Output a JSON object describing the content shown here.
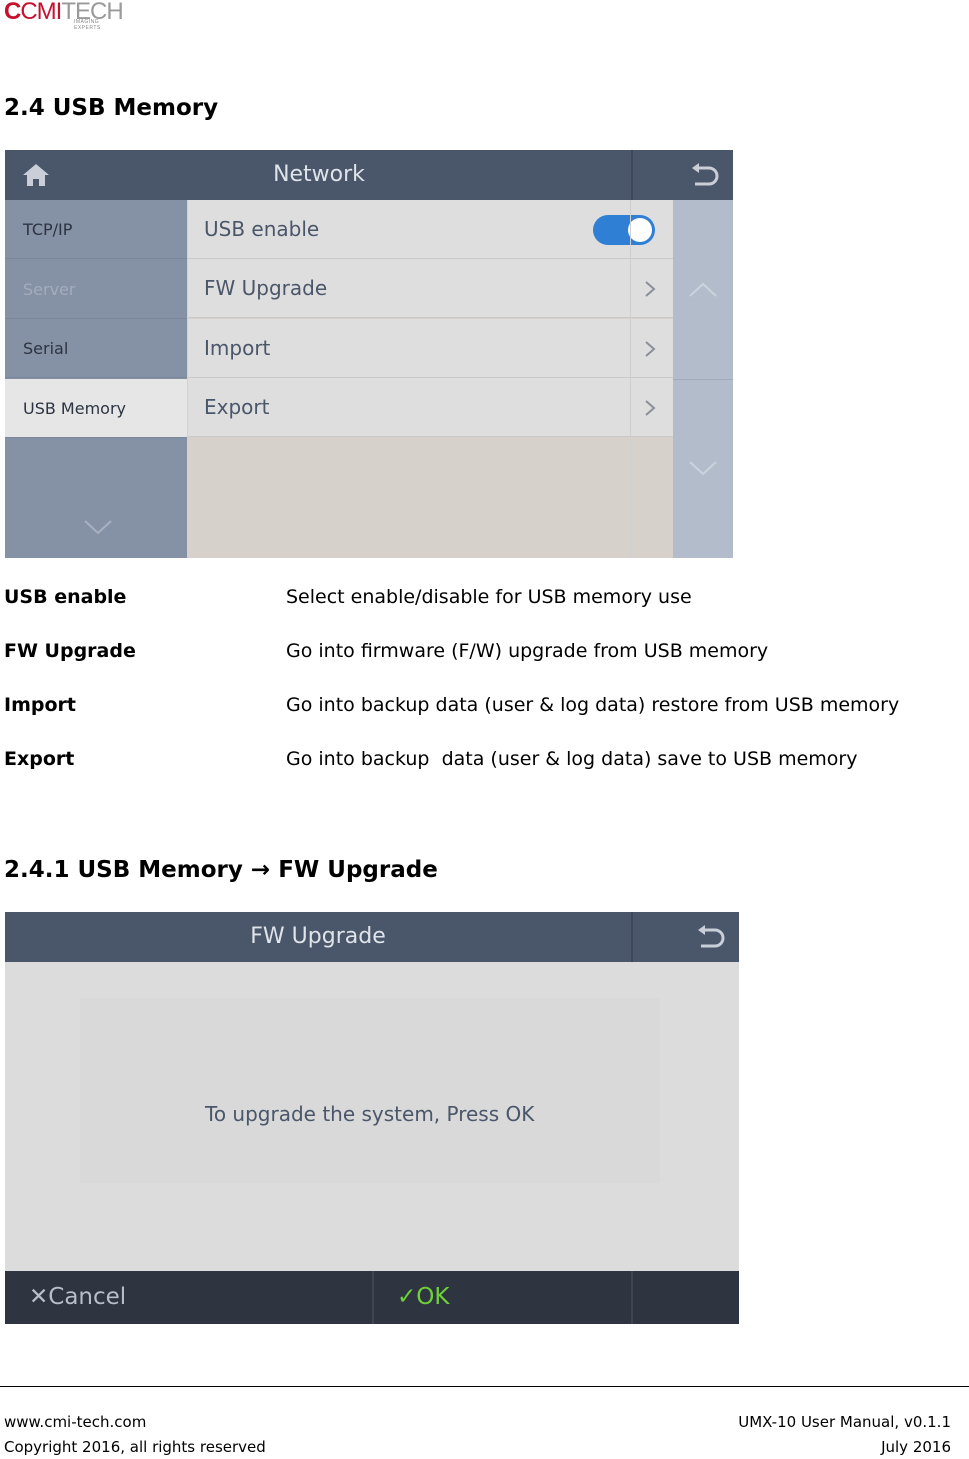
{
  "logo": {
    "mark": "C",
    "brand_main": "CMI",
    "brand_tech": "TECH",
    "tagline": "IMAGING EXPERTS"
  },
  "section1": {
    "heading": "2.4 USB Memory"
  },
  "screen1": {
    "title": "Network",
    "sidebar": [
      {
        "label": "TCP/IP",
        "state": "normal"
      },
      {
        "label": "Server",
        "state": "disabled"
      },
      {
        "label": "Serial",
        "state": "normal"
      },
      {
        "label": "USB Memory",
        "state": "active"
      }
    ],
    "rows": [
      {
        "label": "USB enable",
        "control": "toggle",
        "toggle_on": true
      },
      {
        "label": "FW Upgrade",
        "control": "chevron"
      },
      {
        "label": "Import",
        "control": "chevron"
      },
      {
        "label": "Export",
        "control": "chevron"
      }
    ],
    "icons": {
      "home": "home-icon",
      "back": "back-arrow-icon"
    },
    "colors": {
      "header": "#4a5669",
      "toggle": "#2f7fd4",
      "sidebar": "#8591a5"
    }
  },
  "definitions": [
    {
      "term": "USB enable",
      "desc": "Select enable/disable for USB memory use"
    },
    {
      "term": "FW Upgrade",
      "desc": "Go into firmware (F/W) upgrade from USB memory"
    },
    {
      "term": "Import",
      "desc": "Go into backup data (user & log data) restore from USB memory"
    },
    {
      "term": "Export",
      "desc": "Go into backup  data (user & log data) save to USB memory"
    }
  ],
  "section2": {
    "heading_a": "2.4.1 USB Memory",
    "arrow": "→",
    "heading_b": "FW Upgrade"
  },
  "screen2": {
    "title": "FW Upgrade",
    "message": "To upgrade the system, Press OK",
    "cancel_label": "Cancel",
    "ok_label": "OK",
    "cancel_glyph": "✕",
    "ok_glyph": "✓"
  },
  "footer": {
    "site": "www.cmi-tech.com",
    "copyright": "Copyright 2016, all rights reserved",
    "manual": "UMX-10 User Manual, v0.1.1",
    "date": "July 2016"
  }
}
